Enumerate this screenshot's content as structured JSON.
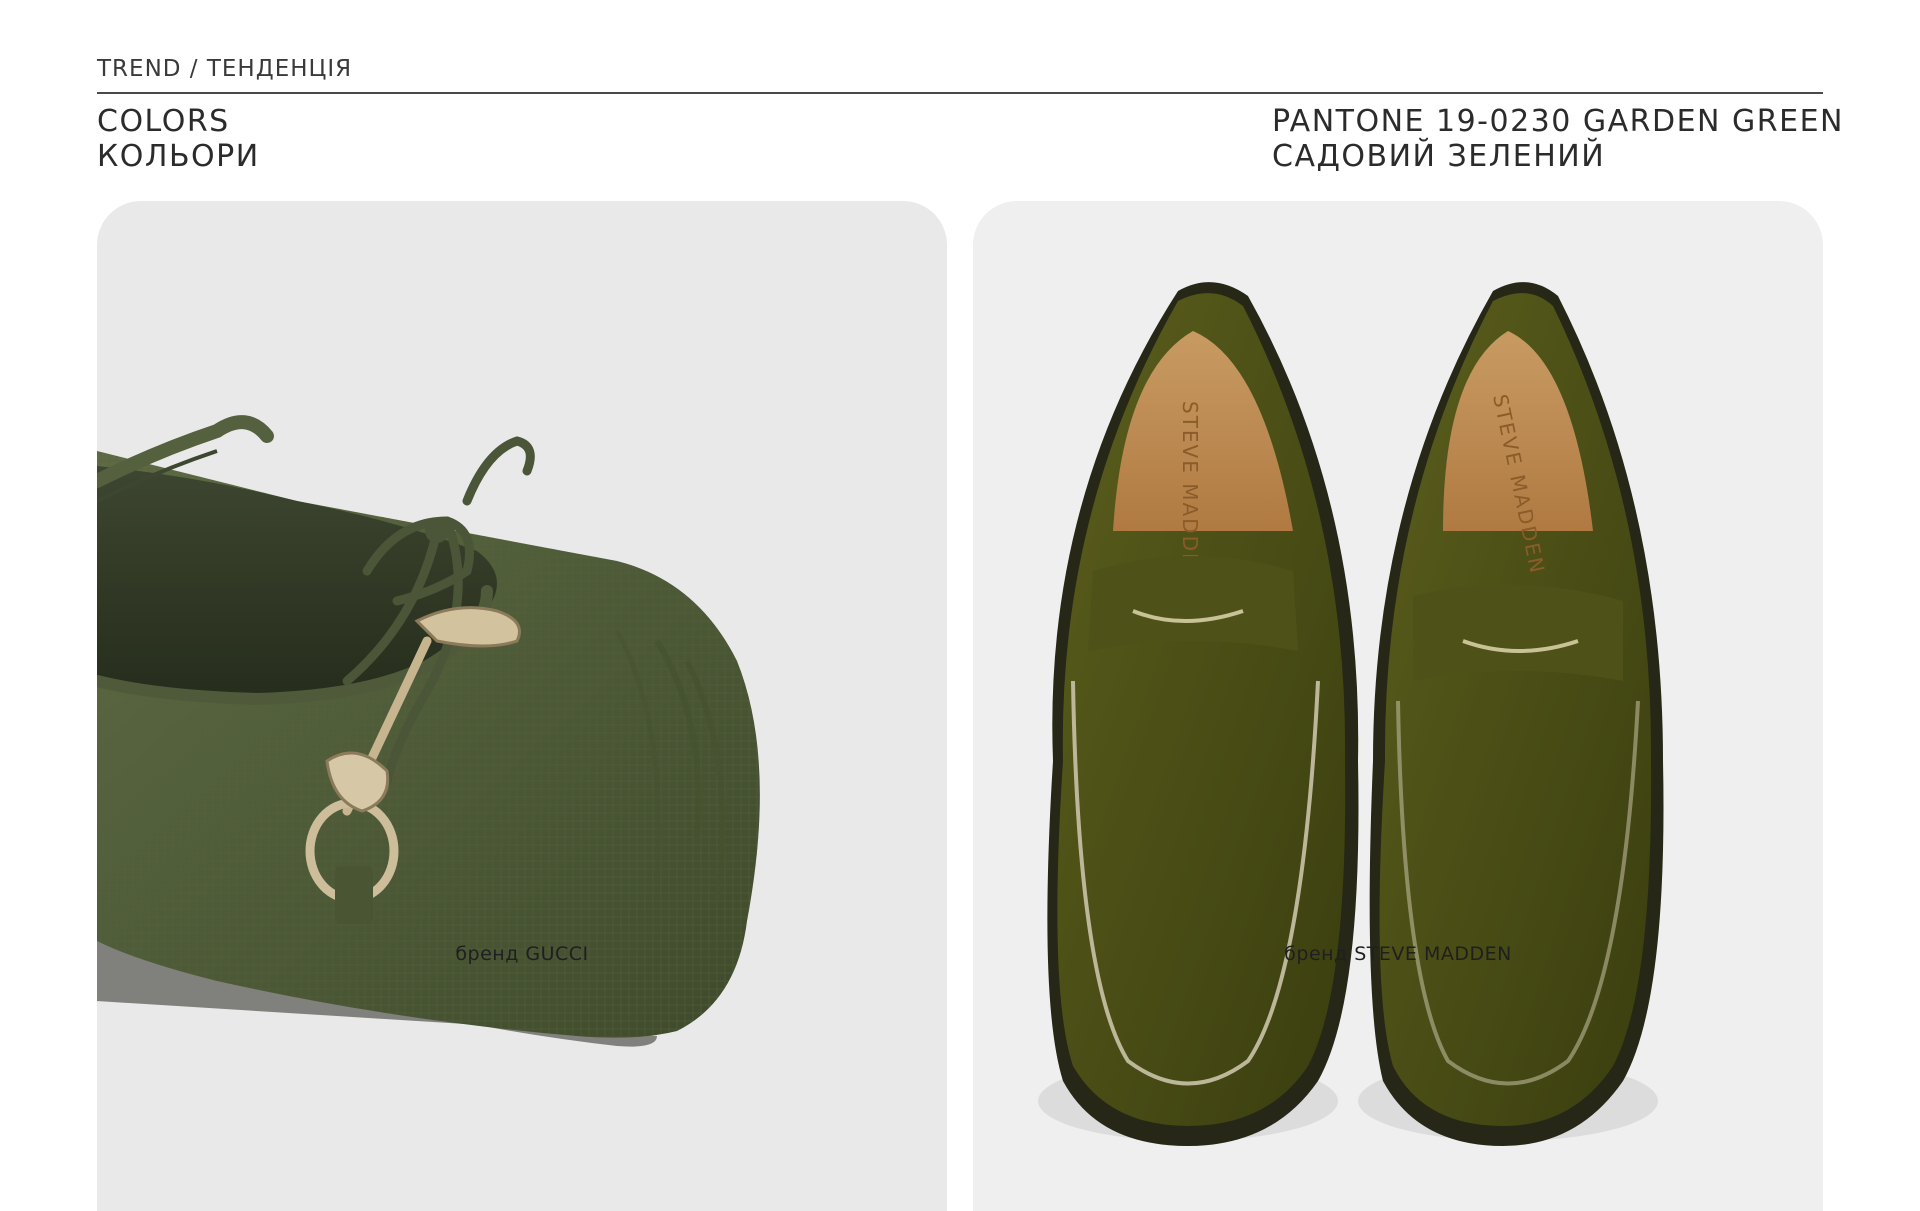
{
  "header": {
    "eyebrow": "TREND / ТЕНДЕНЦІЯ",
    "section_title_en": "COLORS",
    "section_title_ua": "КОЛЬОРИ",
    "color_name_en": "PANTONE 19-0230 GARDEN GREEN",
    "color_name_ua": "САДОВИЙ ЗЕЛЕНИЙ"
  },
  "cards": [
    {
      "caption": "бренд GUCCI",
      "image_icon": "ballet-flat-image"
    },
    {
      "caption": "бренд STEVE MADDEN",
      "image_icon": "loafers-image",
      "insole_logo": "STEVE MADDEN"
    }
  ],
  "colors": {
    "accent_green": "#4d5a37",
    "loafer_green": "#4a4f16",
    "card_bg_left": "#e9e9e9",
    "card_bg_right": "#efefef"
  }
}
